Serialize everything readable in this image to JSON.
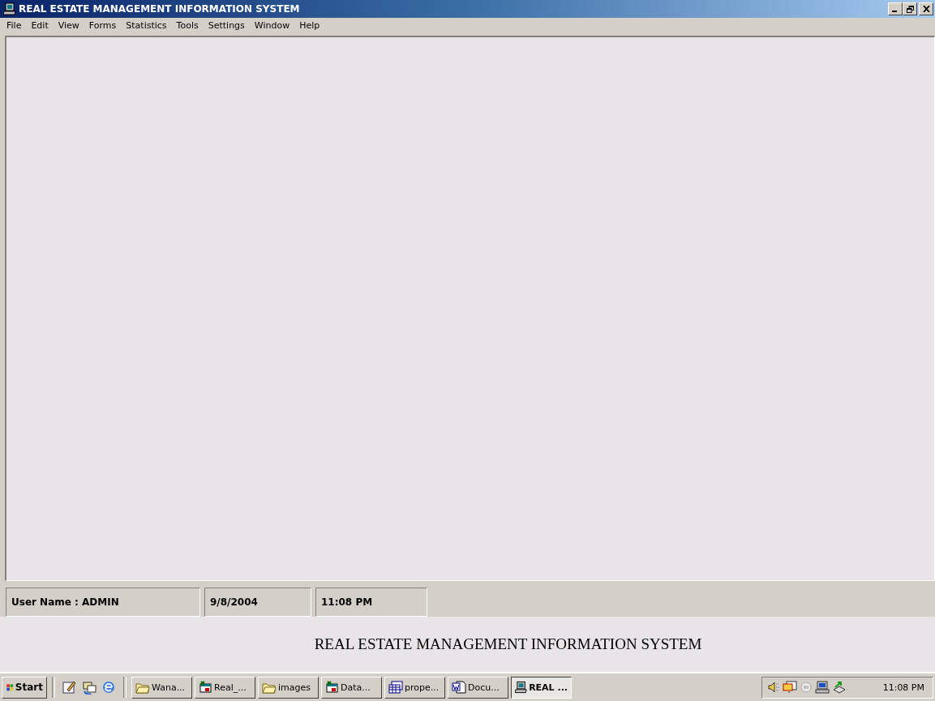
{
  "window": {
    "title": "REAL ESTATE MANAGEMENT INFORMATION SYSTEM"
  },
  "menu": [
    "File",
    "Edit",
    "View",
    "Forms",
    "Statistics",
    "Tools",
    "Settings",
    "Window",
    "Help"
  ],
  "status_bar": [
    {
      "text": "User Name : ADMIN"
    },
    {
      "text": "9/8/2004"
    },
    {
      "text": "11:08 PM"
    }
  ],
  "footer_caption": "REAL ESTATE MANAGEMENT INFORMATION SYSTEM",
  "taskbar": {
    "start": "Start",
    "buttons": [
      {
        "label": "Wana...",
        "kind": "folder",
        "selected": false
      },
      {
        "label": "Real_...",
        "kind": "program",
        "selected": false
      },
      {
        "label": "images",
        "kind": "folder",
        "selected": false
      },
      {
        "label": "Data...",
        "kind": "program",
        "selected": false
      },
      {
        "label": "prope...",
        "kind": "table",
        "selected": false
      },
      {
        "label": "Docu...",
        "kind": "document",
        "selected": false
      },
      {
        "label": "REAL ...",
        "kind": "computer",
        "selected": true
      }
    ],
    "clock": "11:08 PM"
  }
}
